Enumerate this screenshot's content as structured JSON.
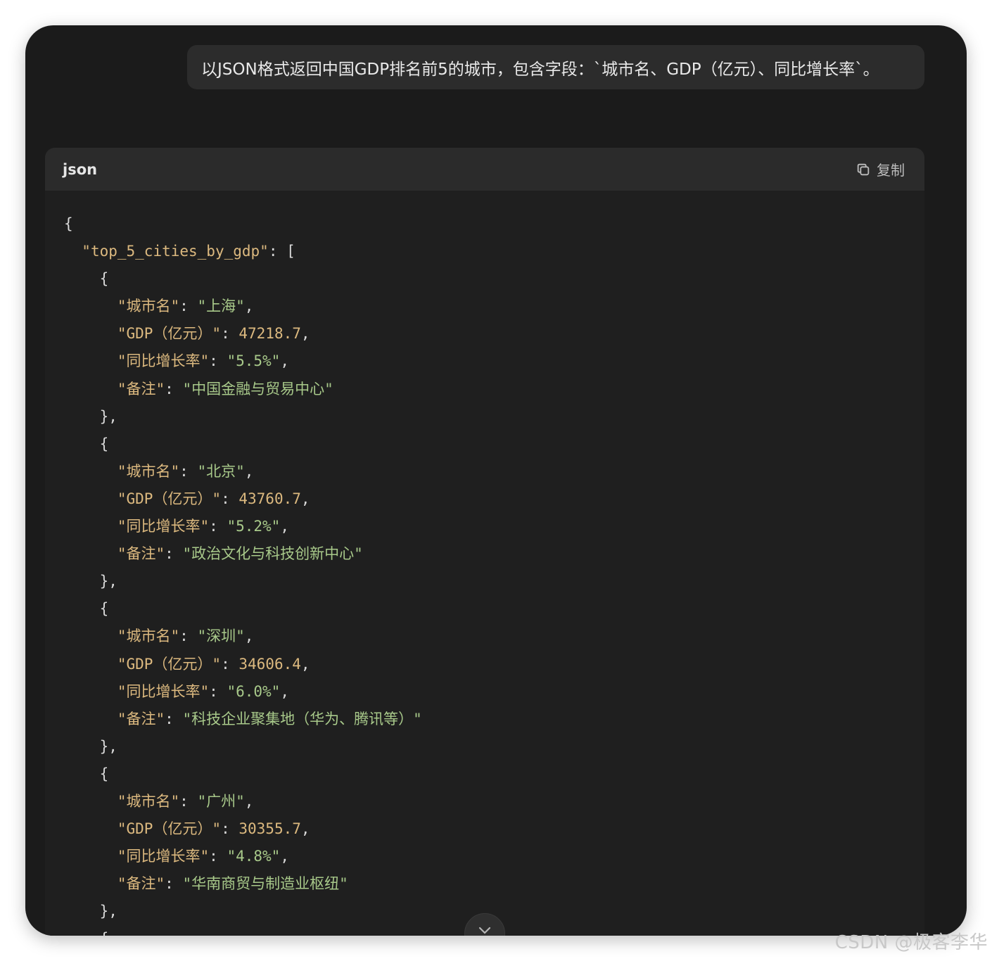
{
  "user_message": "以JSON格式返回中国GDP排名前5的城市，包含字段：`城市名、GDP（亿元）、同比增长率`。",
  "code_block": {
    "language": "json",
    "copy_label": "复制",
    "copy_icon": "copy-icon",
    "lines": [
      {
        "indent": "",
        "parts": [
          {
            "t": "{",
            "c": "punc"
          }
        ]
      },
      {
        "indent": "  ",
        "parts": [
          {
            "t": "\"top_5_cities_by_gdp\"",
            "c": "key"
          },
          {
            "t": ": [",
            "c": "punc"
          }
        ]
      },
      {
        "indent": "    ",
        "parts": [
          {
            "t": "{",
            "c": "punc"
          }
        ]
      },
      {
        "indent": "      ",
        "parts": [
          {
            "t": "\"城市名\"",
            "c": "key"
          },
          {
            "t": ": ",
            "c": "punc"
          },
          {
            "t": "\"上海\"",
            "c": "str"
          },
          {
            "t": ",",
            "c": "punc"
          }
        ]
      },
      {
        "indent": "      ",
        "parts": [
          {
            "t": "\"GDP（亿元）\"",
            "c": "key"
          },
          {
            "t": ": ",
            "c": "punc"
          },
          {
            "t": "47218.7",
            "c": "num"
          },
          {
            "t": ",",
            "c": "punc"
          }
        ]
      },
      {
        "indent": "      ",
        "parts": [
          {
            "t": "\"同比增长率\"",
            "c": "key"
          },
          {
            "t": ": ",
            "c": "punc"
          },
          {
            "t": "\"5.5%\"",
            "c": "str"
          },
          {
            "t": ",",
            "c": "punc"
          }
        ]
      },
      {
        "indent": "      ",
        "parts": [
          {
            "t": "\"备注\"",
            "c": "key"
          },
          {
            "t": ": ",
            "c": "punc"
          },
          {
            "t": "\"中国金融与贸易中心\"",
            "c": "str"
          }
        ]
      },
      {
        "indent": "    ",
        "parts": [
          {
            "t": "},",
            "c": "punc"
          }
        ]
      },
      {
        "indent": "    ",
        "parts": [
          {
            "t": "{",
            "c": "punc"
          }
        ]
      },
      {
        "indent": "      ",
        "parts": [
          {
            "t": "\"城市名\"",
            "c": "key"
          },
          {
            "t": ": ",
            "c": "punc"
          },
          {
            "t": "\"北京\"",
            "c": "str"
          },
          {
            "t": ",",
            "c": "punc"
          }
        ]
      },
      {
        "indent": "      ",
        "parts": [
          {
            "t": "\"GDP（亿元）\"",
            "c": "key"
          },
          {
            "t": ": ",
            "c": "punc"
          },
          {
            "t": "43760.7",
            "c": "num"
          },
          {
            "t": ",",
            "c": "punc"
          }
        ]
      },
      {
        "indent": "      ",
        "parts": [
          {
            "t": "\"同比增长率\"",
            "c": "key"
          },
          {
            "t": ": ",
            "c": "punc"
          },
          {
            "t": "\"5.2%\"",
            "c": "str"
          },
          {
            "t": ",",
            "c": "punc"
          }
        ]
      },
      {
        "indent": "      ",
        "parts": [
          {
            "t": "\"备注\"",
            "c": "key"
          },
          {
            "t": ": ",
            "c": "punc"
          },
          {
            "t": "\"政治文化与科技创新中心\"",
            "c": "str"
          }
        ]
      },
      {
        "indent": "    ",
        "parts": [
          {
            "t": "},",
            "c": "punc"
          }
        ]
      },
      {
        "indent": "    ",
        "parts": [
          {
            "t": "{",
            "c": "punc"
          }
        ]
      },
      {
        "indent": "      ",
        "parts": [
          {
            "t": "\"城市名\"",
            "c": "key"
          },
          {
            "t": ": ",
            "c": "punc"
          },
          {
            "t": "\"深圳\"",
            "c": "str"
          },
          {
            "t": ",",
            "c": "punc"
          }
        ]
      },
      {
        "indent": "      ",
        "parts": [
          {
            "t": "\"GDP（亿元）\"",
            "c": "key"
          },
          {
            "t": ": ",
            "c": "punc"
          },
          {
            "t": "34606.4",
            "c": "num"
          },
          {
            "t": ",",
            "c": "punc"
          }
        ]
      },
      {
        "indent": "      ",
        "parts": [
          {
            "t": "\"同比增长率\"",
            "c": "key"
          },
          {
            "t": ": ",
            "c": "punc"
          },
          {
            "t": "\"6.0%\"",
            "c": "str"
          },
          {
            "t": ",",
            "c": "punc"
          }
        ]
      },
      {
        "indent": "      ",
        "parts": [
          {
            "t": "\"备注\"",
            "c": "key"
          },
          {
            "t": ": ",
            "c": "punc"
          },
          {
            "t": "\"科技企业聚集地（华为、腾讯等）\"",
            "c": "str"
          }
        ]
      },
      {
        "indent": "    ",
        "parts": [
          {
            "t": "},",
            "c": "punc"
          }
        ]
      },
      {
        "indent": "    ",
        "parts": [
          {
            "t": "{",
            "c": "punc"
          }
        ]
      },
      {
        "indent": "      ",
        "parts": [
          {
            "t": "\"城市名\"",
            "c": "key"
          },
          {
            "t": ": ",
            "c": "punc"
          },
          {
            "t": "\"广州\"",
            "c": "str"
          },
          {
            "t": ",",
            "c": "punc"
          }
        ]
      },
      {
        "indent": "      ",
        "parts": [
          {
            "t": "\"GDP（亿元）\"",
            "c": "key"
          },
          {
            "t": ": ",
            "c": "punc"
          },
          {
            "t": "30355.7",
            "c": "num"
          },
          {
            "t": ",",
            "c": "punc"
          }
        ]
      },
      {
        "indent": "      ",
        "parts": [
          {
            "t": "\"同比增长率\"",
            "c": "key"
          },
          {
            "t": ": ",
            "c": "punc"
          },
          {
            "t": "\"4.8%\"",
            "c": "str"
          },
          {
            "t": ",",
            "c": "punc"
          }
        ]
      },
      {
        "indent": "      ",
        "parts": [
          {
            "t": "\"备注\"",
            "c": "key"
          },
          {
            "t": ": ",
            "c": "punc"
          },
          {
            "t": "\"华南商贸与制造业枢纽\"",
            "c": "str"
          }
        ]
      },
      {
        "indent": "    ",
        "parts": [
          {
            "t": "},",
            "c": "punc"
          }
        ]
      },
      {
        "indent": "    ",
        "parts": [
          {
            "t": "{",
            "c": "punc"
          }
        ]
      }
    ]
  },
  "scroll_button_icon": "chevron-down-icon",
  "watermark": "CSDN @极客李华",
  "colors": {
    "background": "#1b1b1b",
    "code_key": "#dcb97f",
    "code_string": "#a8c98a"
  }
}
